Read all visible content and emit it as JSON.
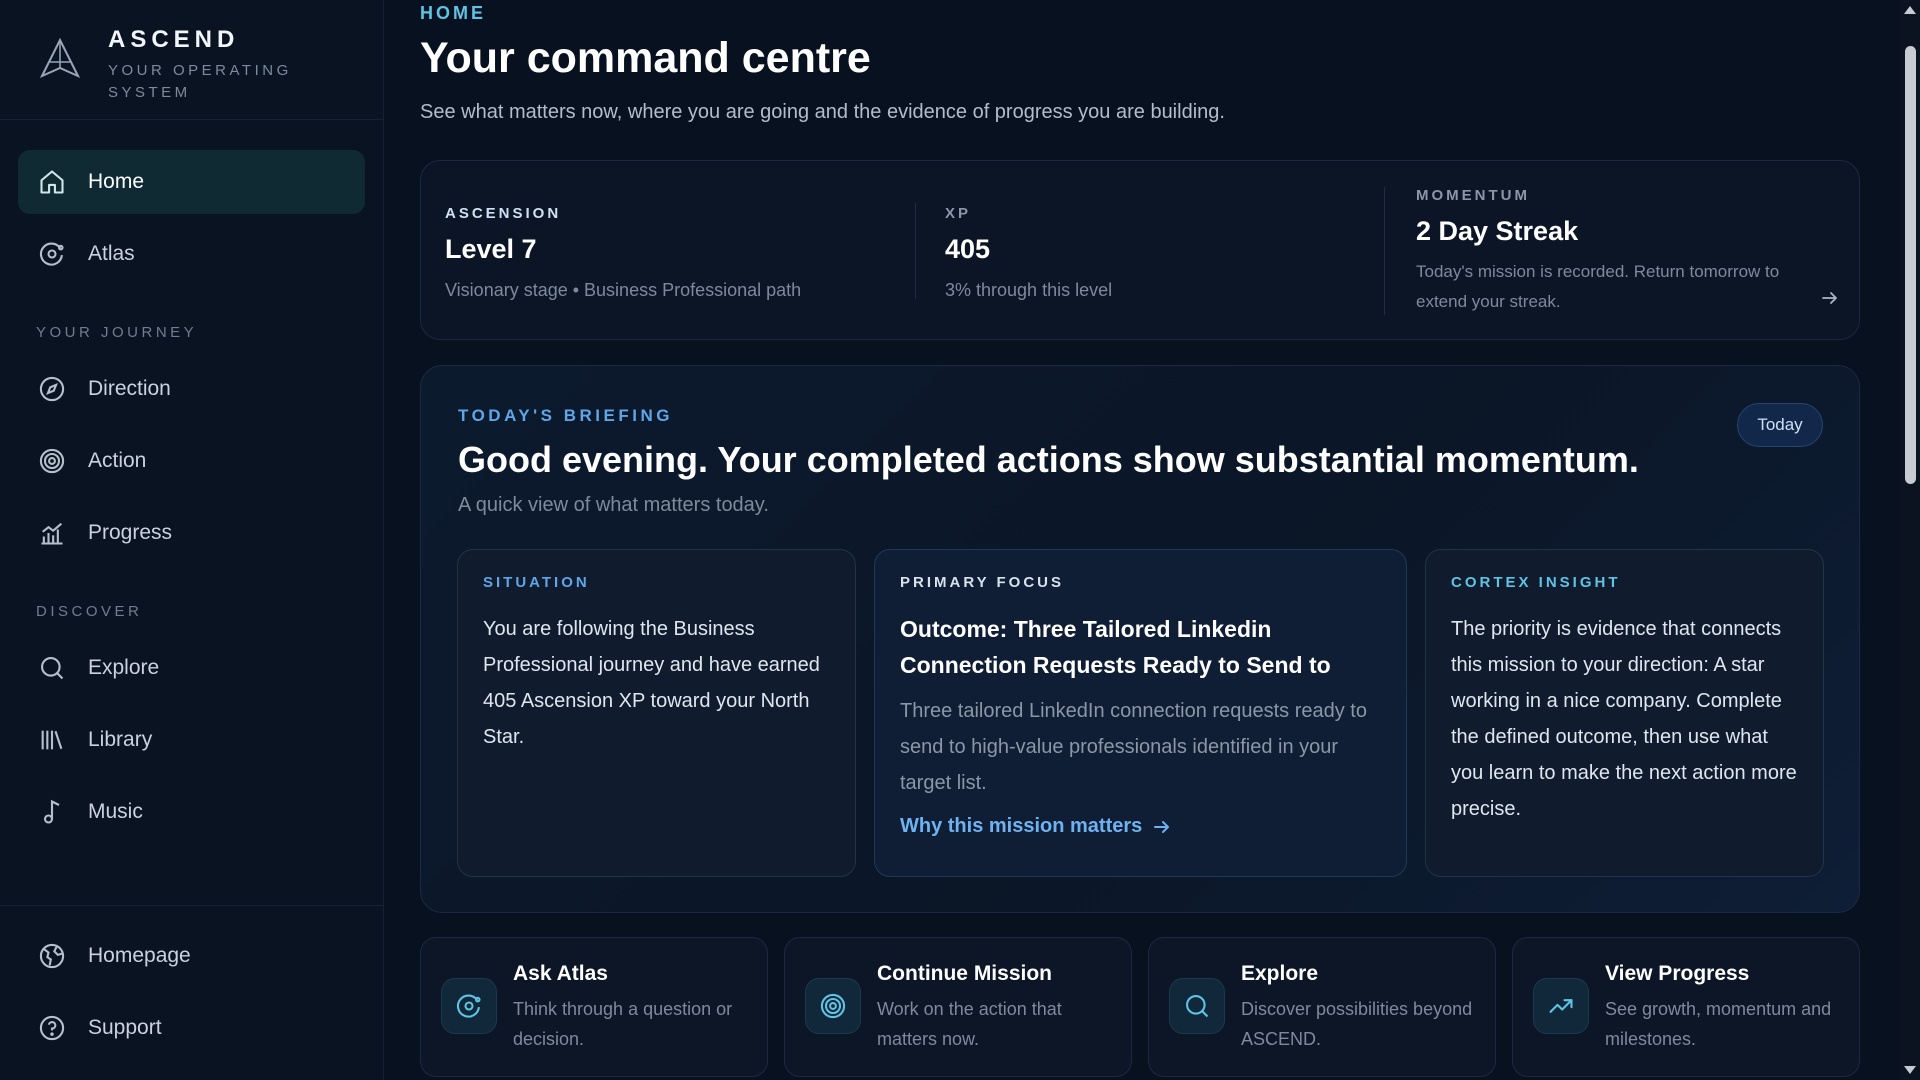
{
  "brand": {
    "name": "ASCEND",
    "tagline": "YOUR OPERATING SYSTEM"
  },
  "nav": {
    "home": "Home",
    "atlas": "Atlas",
    "journey_label": "YOUR JOURNEY",
    "direction": "Direction",
    "action": "Action",
    "progress": "Progress",
    "discover_label": "DISCOVER",
    "explore": "Explore",
    "library": "Library",
    "music": "Music",
    "homepage": "Homepage",
    "support": "Support"
  },
  "header": {
    "eyebrow": "HOME",
    "title": "Your command centre",
    "subtitle": "See what matters now, where you are going and the evidence of progress you are building."
  },
  "stats": {
    "ascension": {
      "label": "ASCENSION",
      "value": "Level 7",
      "sub": "Visionary stage • Business Professional path"
    },
    "xp": {
      "label": "XP",
      "value": "405",
      "sub": "3% through this level"
    },
    "momentum": {
      "label": "MOMENTUM",
      "value": "2 Day Streak",
      "sub": "Today's mission is recorded. Return tomorrow to extend your streak."
    }
  },
  "briefing": {
    "eyebrow": "TODAY'S BRIEFING",
    "title": "Good evening. Your completed actions show substantial momentum.",
    "subtitle": "A quick view of what matters today.",
    "today_button": "Today",
    "situation": {
      "label": "SITUATION",
      "text": "You are following the Business Professional journey and have earned 405 Ascension XP toward your North Star."
    },
    "focus": {
      "label": "PRIMARY FOCUS",
      "title": "Outcome: Three Tailored Linkedin Connection Requests Ready to Send to",
      "desc": "Three tailored LinkedIn connection requests ready to send to high-value professionals identified in your target list.",
      "link": "Why this mission matters"
    },
    "insight": {
      "label": "CORTEX INSIGHT",
      "text": "The priority is evidence that connects this mission to your direction: A star working in a nice company. Complete the defined outcome, then use what you learn to make the next action more precise."
    }
  },
  "quick_actions": [
    {
      "title": "Ask Atlas",
      "desc": "Think through a question or decision."
    },
    {
      "title": "Continue Mission",
      "desc": "Work on the action that matters now."
    },
    {
      "title": "Explore",
      "desc": "Discover possibilities beyond ASCEND."
    },
    {
      "title": "View Progress",
      "desc": "See growth, momentum and milestones."
    }
  ],
  "colors": {
    "accent_cyan": "#5fc3e4",
    "accent_blue": "#5fa6e8",
    "situation_label": "#5fa6e8",
    "focus_label": "#d8e1ec",
    "insight_label": "#5fc3e4"
  }
}
